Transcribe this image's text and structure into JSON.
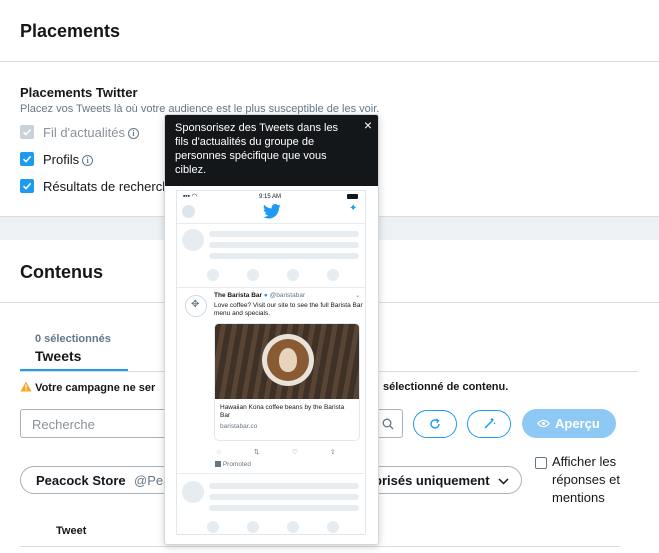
{
  "placements": {
    "heading": "Placements",
    "subheading": "Placements Twitter",
    "description": "Placez vos Tweets là où votre audience est le plus susceptible de les voir.",
    "options": [
      {
        "label": "Fil d'actualités",
        "checked": true,
        "disabled": true
      },
      {
        "label": "Profils",
        "checked": true,
        "disabled": false
      },
      {
        "label": "Résultats de recherche",
        "checked": true,
        "disabled": false
      }
    ]
  },
  "content": {
    "heading": "Contenus",
    "tab_count": "0 sélectionnés",
    "tab_label": "Tweets",
    "warning_left": "Votre campagne ne ser",
    "warning_right": "sélectionné de contenu.",
    "search_placeholder": "Recherche",
    "preview_button": "Aperçu",
    "account_name": "Peacock Store",
    "account_handle": "@Pea",
    "filter_label": "orisés uniquement",
    "replies_checkbox": "Afficher les réponses et mentions",
    "table_header": "Tweet"
  },
  "tooltip": {
    "text": "Sponsorisez des Tweets dans les fils d'actualités du groupe de personnes spécifique que vous ciblez.",
    "close": "×"
  },
  "phone": {
    "time": "9:15 AM",
    "tweet_name": "The Barista Bar",
    "tweet_handle": "@baristabar",
    "tweet_text": "Love coffee? Visit our site to see the full Barista Bar menu and specials.",
    "card_title": "Hawaiian Kona coffee beans by the Barista Bar",
    "card_domain": "baristabar.co",
    "promoted": "Promoted"
  },
  "colors": {
    "accent": "#1d9bf0",
    "warning": "#f5a623",
    "preview_button_bg": "#8ec8f4"
  }
}
